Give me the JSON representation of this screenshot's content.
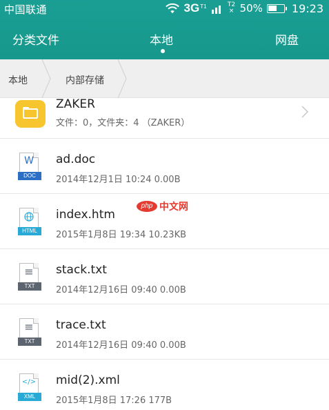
{
  "status_bar": {
    "carrier": "中国联通",
    "network": "3G",
    "network_sub": "T1",
    "sim2_label": "T2",
    "battery": "50%",
    "time": "19:23",
    "icons": [
      "wifi-icon",
      "signal-icon",
      "battery-icon"
    ]
  },
  "tabs": [
    {
      "label": "分类文件",
      "active": false
    },
    {
      "label": "本地",
      "active": true
    },
    {
      "label": "网盘",
      "active": false
    }
  ],
  "breadcrumb": [
    "本地",
    "内部存储"
  ],
  "files": [
    {
      "name": "ZAKER",
      "meta": "文件：0，文件夹：4    （ZAKER）",
      "type": "folder",
      "icon": "folder-icon"
    },
    {
      "name": "ad.doc",
      "meta": "2014年12月1日 10:24 0.00B",
      "type": "doc",
      "tag": "DOC",
      "glyph": "W",
      "color": "#2b6ec3"
    },
    {
      "name": "index.htm",
      "meta": "2015年1月8日 19:34 10.23KB",
      "type": "html",
      "tag": "HTML",
      "glyph": "🌐",
      "color": "#29a9d6"
    },
    {
      "name": "stack.txt",
      "meta": "2014年12月16日 09:40 0.00B",
      "type": "txt",
      "tag": "TXT",
      "glyph": "≡",
      "color": "#5c6470"
    },
    {
      "name": "trace.txt",
      "meta": "2014年12月16日 09:40 0.00B",
      "type": "txt",
      "tag": "TXT",
      "glyph": "≡",
      "color": "#5c6470"
    },
    {
      "name": "mid(2).xml",
      "meta": "2015年1月8日 17:26 177B",
      "type": "xml",
      "tag": "XML",
      "glyph": "</>",
      "color": "#29a9d6"
    }
  ],
  "watermark": {
    "logo": "php",
    "text": "中文网"
  },
  "colors": {
    "accent": "#17988c",
    "folder": "#f7c52d"
  }
}
